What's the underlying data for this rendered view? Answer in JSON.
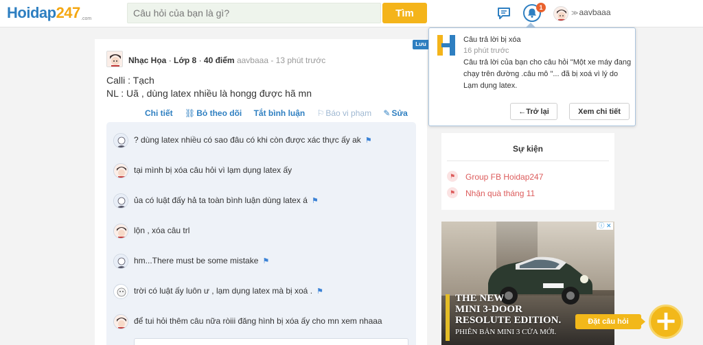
{
  "header": {
    "logo_text": "Hoidap",
    "logo_num": "247",
    "logo_sub": ".com",
    "search_placeholder": "Câu hỏi của bạn là gì?",
    "search_button": "Tìm",
    "notification_count": "1",
    "username": "aavbaaa",
    "icons": [
      "chat-icon",
      "bell-icon",
      "chevron-down-icon"
    ]
  },
  "post": {
    "author": "Nhạc Họa",
    "grade": "Lớp 8",
    "points": "40 điểm",
    "posted_by": "aavbaaa",
    "time": "13 phút trước",
    "line1": "Calli : Tạch",
    "line2": "NL : Uã , dùng latex nhiều là hongg được hã mn",
    "actions": {
      "detail": "Chi tiết",
      "unfollow": "Bỏ theo dõi",
      "disable_comments": "Tắt bình luận",
      "report": "Báo vi phạm",
      "edit": "Sửa"
    },
    "save_tag": "Lưu"
  },
  "comments": [
    {
      "text": "? dùng latex nhiều có sao đâu có khi còn được xác thực ấy ak",
      "flag": true
    },
    {
      "text": "tại mình bị xóa câu hỏi vì lạm dụng latex ấy",
      "flag": false
    },
    {
      "text": "ủa có luật đấy hả ta toàn bình luận dùng latex á",
      "flag": true
    },
    {
      "text": "lộn , xóa câu trl",
      "flag": false
    },
    {
      "text": "hm...There must be some mistake",
      "flag": true
    },
    {
      "text": "trời có luật ấy luôn ư , lạm dụng latex mà bị xoá .",
      "flag": true
    },
    {
      "text": "để tui hỏi thêm câu nữa ròiii đăng hình bị xóa ấy cho mn xem nhaaa",
      "flag": false
    }
  ],
  "notification": {
    "title": "Câu trả lời bị xóa",
    "time": "16 phút trước",
    "body": "Câu trả lời của bạn cho câu hỏi \"Một xe máy đang chạy trên đường .câu mô  \"... đã bị xoá vì lý do Lạm dụng latex.",
    "back_button": "←Trở lại",
    "detail_button": "Xem chi tiết"
  },
  "events": {
    "title": "Sự kiện",
    "items": [
      "Group FB Hoidap247",
      "Nhận quà tháng 11"
    ]
  },
  "ad": {
    "headline1": "THE NEW",
    "headline2": "MINI 3-DOOR",
    "headline3": "RESOLUTE EDITION.",
    "subline": "PHIÊN BẢN MINI 3 CỬA MỚI.",
    "close_label": "ⓘ ✕"
  },
  "fab": {
    "label": "Đặt câu hỏi",
    "symbol": "+"
  },
  "colors": {
    "brand_blue": "#2e7fc1",
    "brand_yellow": "#f4b41a",
    "event_red": "#dc5b5b",
    "badge_orange": "#e9622f"
  }
}
